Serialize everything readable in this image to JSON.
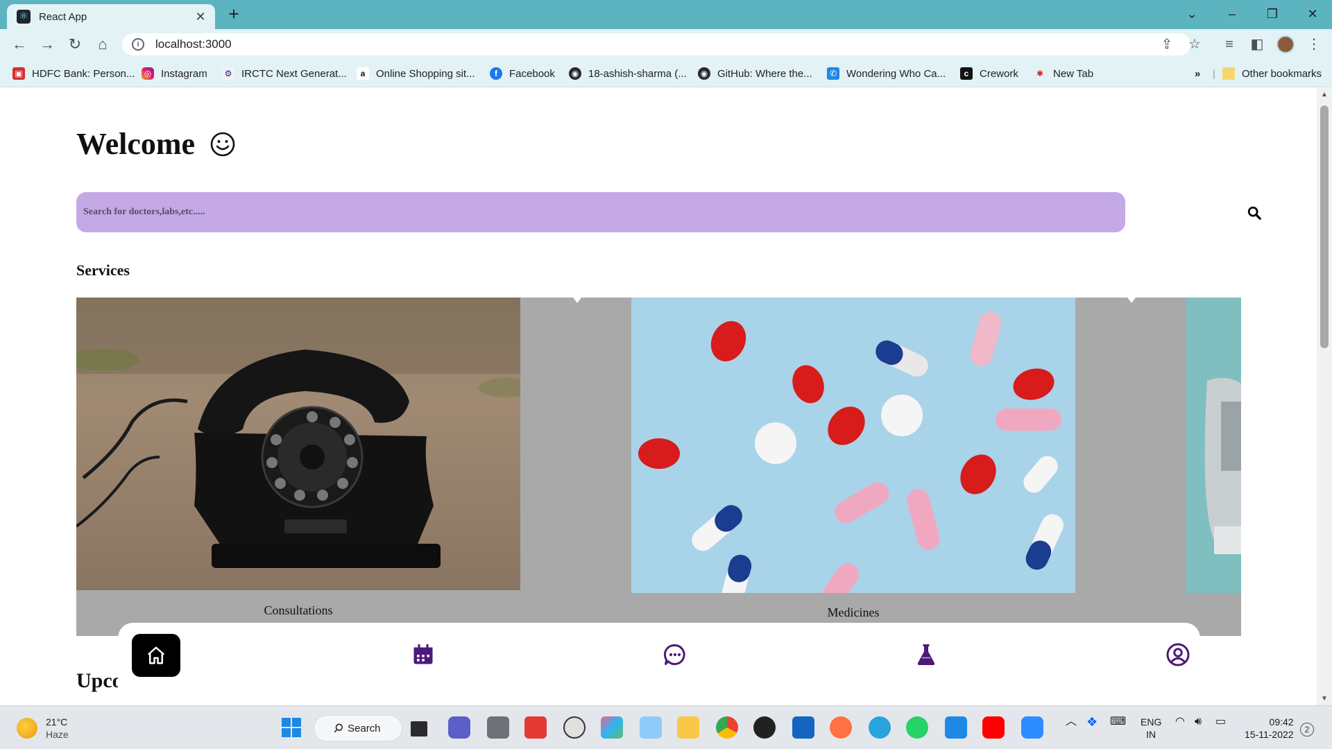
{
  "browser": {
    "tab_title": "React App",
    "url": "localhost:3000",
    "bookmarks": [
      {
        "label": "HDFC Bank: Person...",
        "icon": "hdfc-icon"
      },
      {
        "label": "Instagram",
        "icon": "instagram-icon"
      },
      {
        "label": "IRCTC Next Generat...",
        "icon": "irctc-icon"
      },
      {
        "label": "Online Shopping sit...",
        "icon": "amazon-icon"
      },
      {
        "label": "Facebook",
        "icon": "facebook-icon"
      },
      {
        "label": "18-ashish-sharma (...",
        "icon": "github-icon"
      },
      {
        "label": "GitHub: Where the...",
        "icon": "github-icon"
      },
      {
        "label": "Wondering Who Ca...",
        "icon": "truecaller-icon"
      },
      {
        "label": "Crework",
        "icon": "crework-icon"
      },
      {
        "label": "New Tab",
        "icon": "newtab-icon"
      }
    ],
    "bookmarks_overflow": "»",
    "other_bookmarks": "Other bookmarks"
  },
  "page": {
    "welcome": "Welcome",
    "search_placeholder": "Search for doctors,labs,etc.....",
    "services_title": "Services",
    "services": [
      {
        "label": "Consultations",
        "image": "rotary-telephone"
      },
      {
        "label": "Medicines",
        "image": "pills-capsules"
      },
      {
        "label": "",
        "image": "lab-equipment"
      }
    ],
    "upcoming_partial": "Upco",
    "bottom_nav": [
      "home-icon",
      "calendar-icon",
      "chat-icon",
      "flask-icon",
      "profile-icon"
    ]
  },
  "taskbar": {
    "temperature": "21°C",
    "weather": "Haze",
    "search_label": "Search",
    "lang_line1": "ENG",
    "lang_line2": "IN",
    "time": "09:42",
    "date": "15-11-2022",
    "notifications": "2"
  },
  "colors": {
    "tabstrip": "#5db4c1",
    "toolbar": "#e2f2f5",
    "search_bar": "#c5a8e6",
    "carousel_bg": "#a9a9a9",
    "nav_accent": "#4b1a7a"
  }
}
